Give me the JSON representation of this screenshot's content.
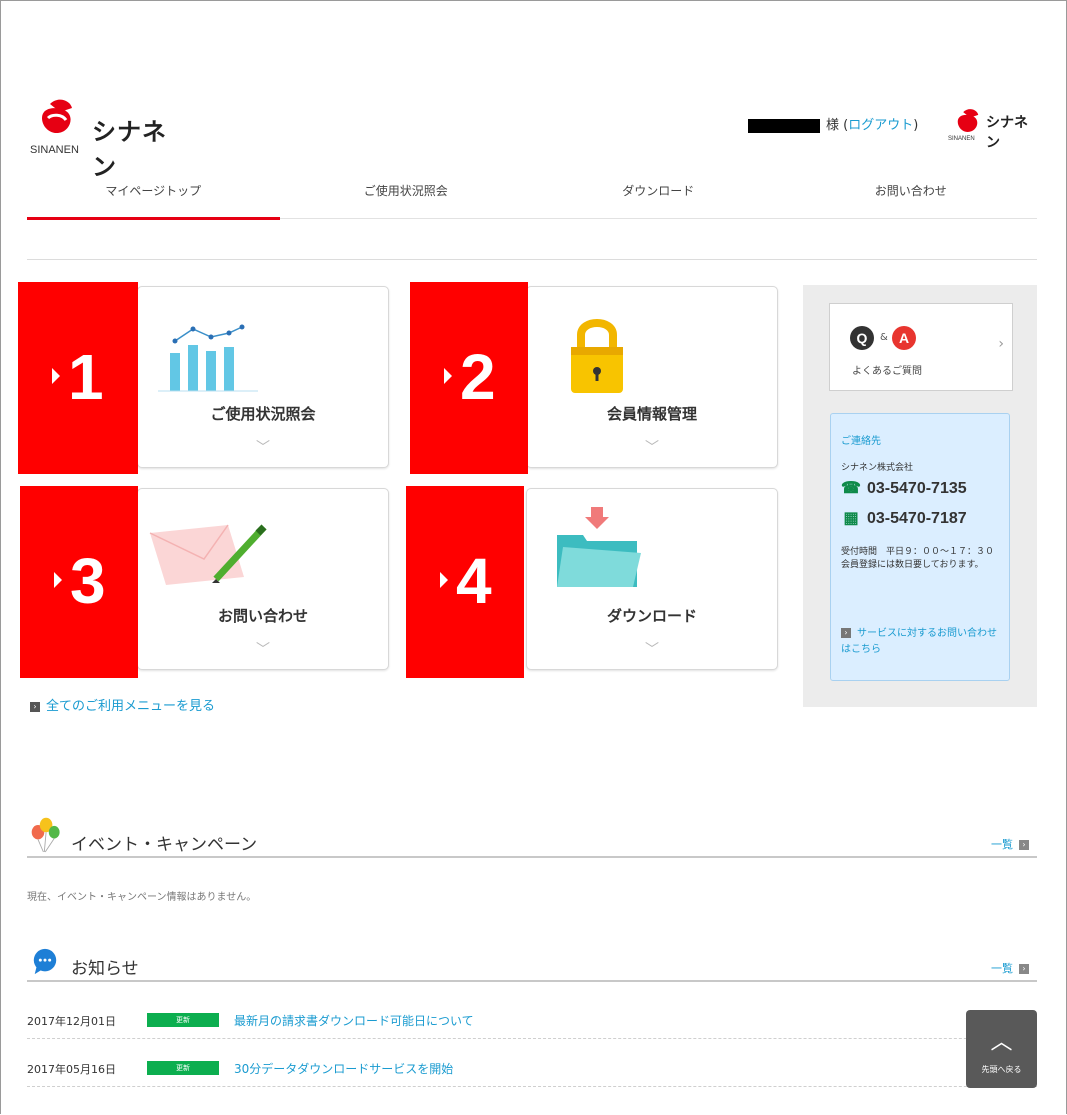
{
  "header": {
    "logo_name": "シナネン",
    "logo_sub": "SINANEN",
    "user_suffix": "様",
    "logout_open": "(",
    "logout_label": "ログアウト",
    "logout_close": ")",
    "small_logo_name": "シナネン",
    "small_logo_sub": "SINANEN"
  },
  "nav": {
    "tabs": [
      {
        "label": "マイページトップ"
      },
      {
        "label": "ご使用状況照会"
      },
      {
        "label": "ダウンロード"
      },
      {
        "label": "お問い合わせ"
      }
    ]
  },
  "cards": [
    {
      "badge": "1",
      "label": "ご使用状況照会"
    },
    {
      "badge": "2",
      "label": "会員情報管理"
    },
    {
      "badge": "3",
      "label": "お問い合わせ"
    },
    {
      "badge": "4",
      "label": "ダウンロード"
    }
  ],
  "all_menu_link": "全てのご利用メニューを見る",
  "sidebar": {
    "faq_q": "Q",
    "faq_amp": "&",
    "faq_a": "A",
    "faq_label": "よくあるご質問",
    "contact_title": "ご連絡先",
    "company": "シナネン株式会社",
    "tel": "03-5470-7135",
    "fax": "03-5470-7187",
    "hours": "受付時間　平日９：００～１７：３０ 会員登録には数日要しております。",
    "service_link": "サービスに対するお問い合わせはこちら"
  },
  "events": {
    "title": "イベント・キャンペーン",
    "more": "一覧",
    "empty": "現在、イベント・キャンペーン情報はありません。"
  },
  "news": {
    "title": "お知らせ",
    "more": "一覧",
    "items": [
      {
        "date": "2017年12月01日",
        "tag": "更新",
        "title": "最新月の請求書ダウンロード可能日について"
      },
      {
        "date": "2017年05月16日",
        "tag": "更新",
        "title": "30分データダウンロードサービスを開始"
      }
    ]
  },
  "back_to_top": "先頭へ戻る",
  "colors": {
    "brand_red": "#e60013",
    "link_blue": "#1a9bd0",
    "tag_green": "#0cae4f",
    "contact_bg": "#dbeeff"
  }
}
